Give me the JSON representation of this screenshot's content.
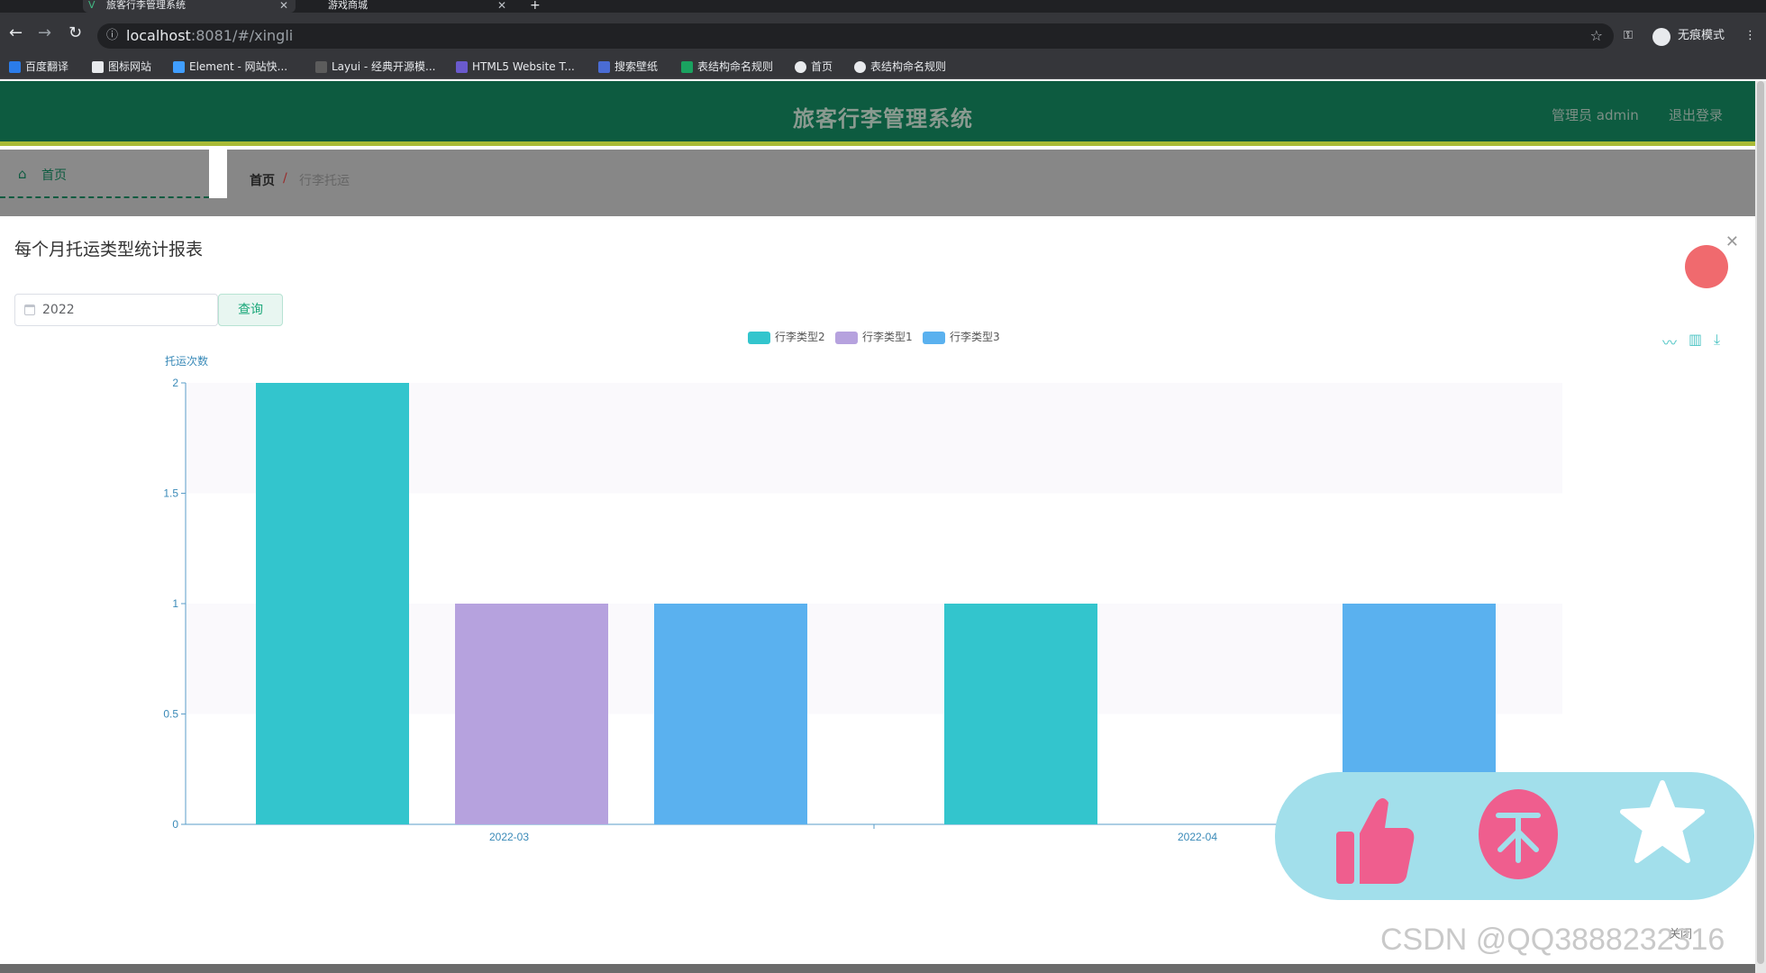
{
  "browser": {
    "tabs": [
      {
        "label": "旅客行李管理系统",
        "active": true
      },
      {
        "label": "游戏商城",
        "active": false
      }
    ],
    "url_host": "localhost",
    "url_path": ":8081/#/xingli",
    "profile_label": "无痕模式",
    "bookmarks": [
      "百度翻译",
      "图标网站",
      "Element - 网站快...",
      "Layui - 经典开源模...",
      "HTML5 Website T...",
      "搜索壁纸",
      "表结构命名规则",
      "首页",
      "表结构命名规则"
    ]
  },
  "app": {
    "title": "旅客行李管理系统",
    "user_label": "管理员 admin",
    "logout_label": "退出登录",
    "sidebar_home": "首页",
    "breadcrumb_home": "首页",
    "breadcrumb_sep": "/",
    "breadcrumb_current": "行李托运"
  },
  "dialog": {
    "title": "每个月托运类型统计报表",
    "year_value": "2022",
    "query_label": "查询",
    "close_label": "关闭"
  },
  "watermark": "CSDN @QQ3888232316",
  "colors": {
    "header": "#0d5b40",
    "series_type2": "#33c5cd",
    "series_type1": "#b6a2de",
    "series_type3": "#5ab1ef",
    "fab_bg": "#a2dfeb",
    "fab_pink": "#ef5e8e"
  },
  "fab_icons": [
    "thumbs-up-icon",
    "coin-icon",
    "star-icon"
  ],
  "chart_data": {
    "type": "bar",
    "ylabel": "托运次数",
    "ylim": [
      0,
      2
    ],
    "yticks": [
      "0",
      "0.5",
      "1",
      "1.5",
      "2"
    ],
    "categories": [
      "2022-03",
      "2022-04"
    ],
    "series": [
      {
        "name": "行李类型2",
        "values": [
          2,
          1
        ]
      },
      {
        "name": "行李类型1",
        "values": [
          1,
          0
        ]
      },
      {
        "name": "行李类型3",
        "values": [
          1,
          1
        ]
      }
    ],
    "legend_position": "top-center",
    "toolbox": [
      "line-chart-icon",
      "bar-chart-icon",
      "download-icon"
    ]
  }
}
